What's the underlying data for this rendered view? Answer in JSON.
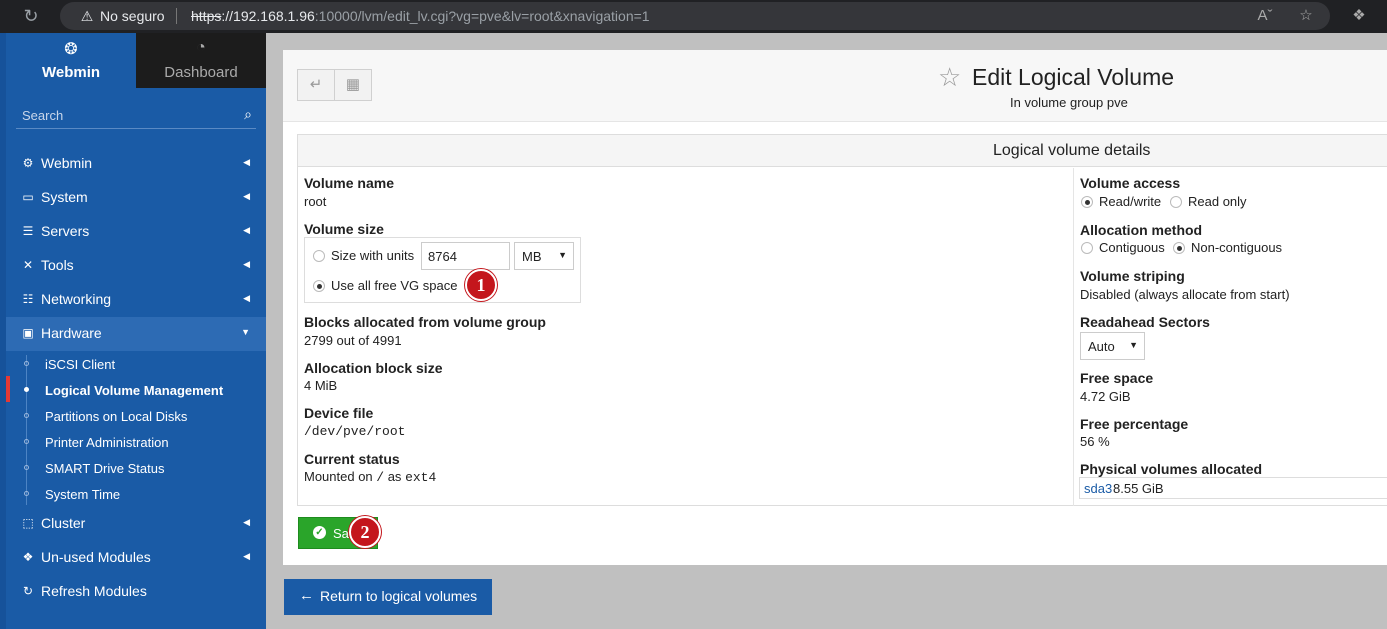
{
  "browser": {
    "security_label": "No seguro",
    "url_scheme": "https",
    "url_host": "://192.168.1.96",
    "url_rest": ":10000/lvm/edit_lv.cgi?vg=pve&lv=root&xnavigation=1"
  },
  "sidebar": {
    "tabs": [
      {
        "label": "Webmin",
        "icon": "webmin-logo-icon"
      },
      {
        "label": "Dashboard",
        "icon": "dashboard-gauge-icon"
      }
    ],
    "search_placeholder": "Search",
    "menu": [
      {
        "label": "Webmin",
        "icon": "gear-icon"
      },
      {
        "label": "System",
        "icon": "monitor-icon"
      },
      {
        "label": "Servers",
        "icon": "list-icon"
      },
      {
        "label": "Tools",
        "icon": "wrench-icon"
      },
      {
        "label": "Networking",
        "icon": "network-icon"
      },
      {
        "label": "Hardware",
        "icon": "hdd-icon"
      },
      {
        "label": "Cluster",
        "icon": "layers-icon"
      },
      {
        "label": "Un-used Modules",
        "icon": "puzzle-icon"
      },
      {
        "label": "Refresh Modules",
        "icon": "refresh-icon"
      }
    ],
    "submenu": [
      {
        "label": "iSCSI Client"
      },
      {
        "label": "Logical Volume Management"
      },
      {
        "label": "Partitions on Local Disks"
      },
      {
        "label": "Printer Administration"
      },
      {
        "label": "SMART Drive Status"
      },
      {
        "label": "System Time"
      }
    ]
  },
  "page": {
    "title": "Edit Logical Volume",
    "subtitle": "In volume group pve"
  },
  "panel": {
    "header": "Logical volume details",
    "left": {
      "volume_name_label": "Volume name",
      "volume_name": "root",
      "volume_size_label": "Volume size",
      "size_with_units_label": "Size with units",
      "size_value": "8764",
      "size_unit": "MB",
      "use_all_label": "Use all free VG space",
      "blocks_label": "Blocks allocated from volume group",
      "blocks_value": "2799 out of 4991",
      "alloc_block_label": "Allocation block size",
      "alloc_block_value": "4 MiB",
      "device_label": "Device file",
      "device_value": "/dev/pve/root",
      "status_label": "Current status",
      "status_text": "Mounted on ",
      "status_mount": "/",
      "status_as": " as ",
      "status_fs": "ext4"
    },
    "right": {
      "access_label": "Volume access",
      "access_rw": "Read/write",
      "access_ro": "Read only",
      "alloc_method_label": "Allocation method",
      "alloc_contiguous": "Contiguous",
      "alloc_noncontiguous": "Non-contiguous",
      "striping_label": "Volume striping",
      "striping_value": "Disabled (always allocate from start)",
      "readahead_label": "Readahead Sectors",
      "readahead_value": "Auto",
      "free_space_label": "Free space",
      "free_space_value": "4.72 GiB",
      "free_pct_label": "Free percentage",
      "free_pct_value": "56 %",
      "pv_label": "Physical volumes allocated",
      "pv_name": "sda3",
      "pv_size": "8.55 GiB"
    }
  },
  "buttons": {
    "save": "Sa",
    "return": "Return to logical volumes"
  },
  "annotations": [
    "1",
    "2"
  ]
}
